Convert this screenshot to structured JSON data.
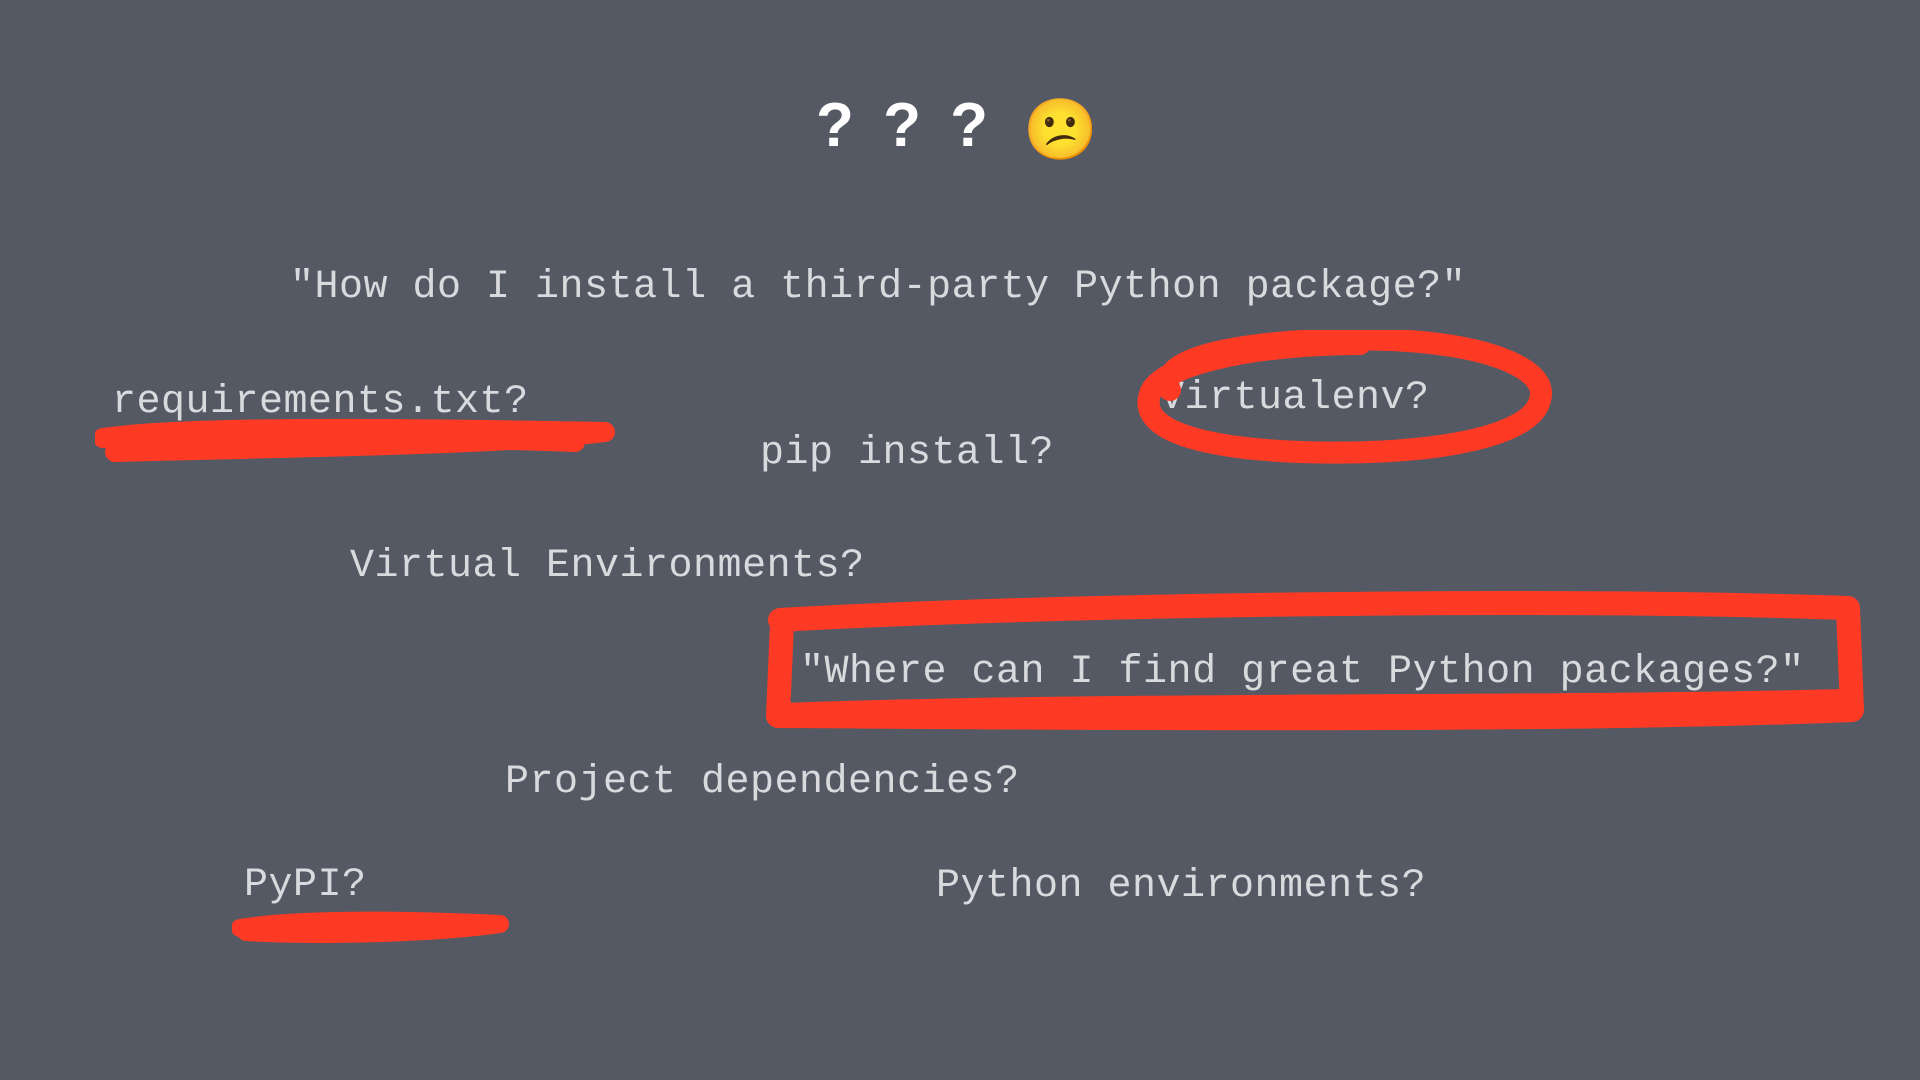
{
  "slide": {
    "title_text": "? ? ?",
    "title_emoji": "😕",
    "terms": {
      "q1": "\"How do I install a third-party Python package?\"",
      "req": "requirements.txt?",
      "pip": "pip install?",
      "venv": "Virtualenv?",
      "venvs": "Virtual Environments?",
      "q2": "\"Where can I find great Python packages?\"",
      "proj": "Project dependencies?",
      "pypi": "PyPI?",
      "pyenv": "Python environments?"
    },
    "annotations": {
      "color": "#ff3a24"
    }
  }
}
